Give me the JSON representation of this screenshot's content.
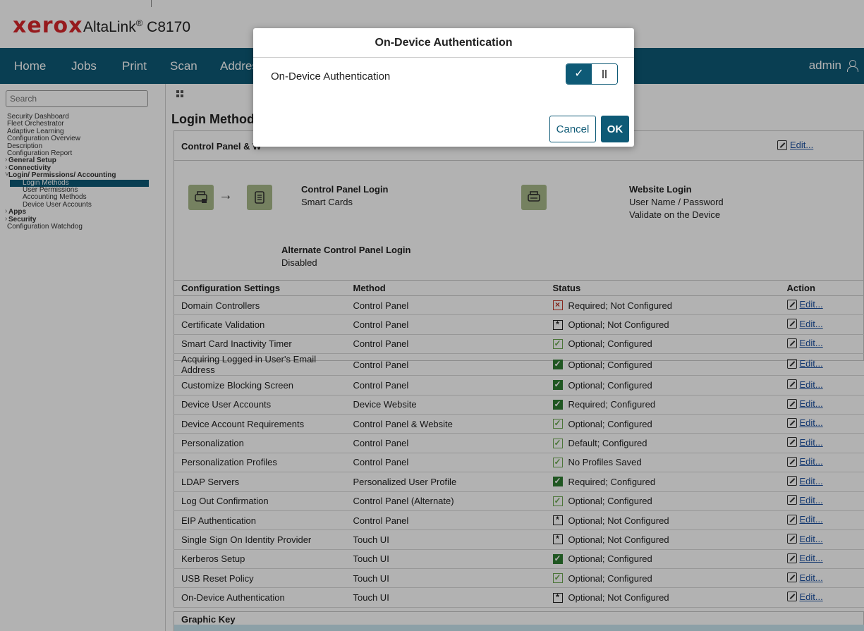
{
  "brand": {
    "logo": "xerox",
    "product": "AltaLink",
    "product_reg": "®",
    "model": " C8170"
  },
  "nav": {
    "items": [
      "Home",
      "Jobs",
      "Print",
      "Scan",
      "Address Book"
    ],
    "user": "admin",
    "user_icon": "user-icon"
  },
  "sidebar": {
    "search_placeholder": "Search",
    "items": {
      "security_dashboard": "Security Dashboard",
      "fleet_orchestrator": "Fleet Orchestrator",
      "adaptive_learning": "Adaptive Learning",
      "configuration_overview": "Configuration Overview",
      "description": "Description",
      "configuration_report": "Configuration Report",
      "general_setup": "General Setup",
      "connectivity": "Connectivity",
      "login_group": "Login/ Permissions/ Accounting",
      "login_methods": "Login Methods",
      "user_permissions": "User Permissions",
      "accounting_methods": "Accounting Methods",
      "device_user_accounts": "Device User Accounts",
      "apps": "Apps",
      "security": "Security",
      "configuration_watchdog": "Configuration Watchdog"
    }
  },
  "main": {
    "page_title": "Login Methods",
    "panel_title": "Control Panel & W",
    "edit_label": "Edit...",
    "control_panel_login": {
      "title": "Control Panel Login",
      "value": "Smart Cards"
    },
    "website_login": {
      "title": "Website Login",
      "line1": "User Name / Password",
      "line2": "Validate on the Device"
    },
    "alternate_login": {
      "title": "Alternate Control Panel Login",
      "value": "Disabled"
    },
    "table": {
      "headers": [
        "Configuration Settings",
        "Method",
        "Status",
        "Action"
      ],
      "rows": [
        {
          "setting": "Domain Controllers",
          "method": "Control Panel",
          "status": "Required; Not Configured",
          "icon": "x",
          "action": "Edit..."
        },
        {
          "setting": "Certificate Validation",
          "method": "Control Panel",
          "status": "Optional; Not Configured",
          "icon": "star",
          "action": "Edit..."
        },
        {
          "setting": "Smart Card Inactivity Timer",
          "method": "Control Panel",
          "status": "Optional; Configured",
          "icon": "check-light",
          "action": "Edit..."
        },
        {
          "setting": "Acquiring Logged in User's Email Address",
          "method": "Control Panel",
          "status": "Optional; Configured",
          "icon": "check-dark",
          "action": "Edit..."
        },
        {
          "setting": "Customize Blocking Screen",
          "method": "Control Panel",
          "status": "Optional; Configured",
          "icon": "check-dark",
          "action": "Edit..."
        },
        {
          "setting": "Device User Accounts",
          "method": "Device Website",
          "status": "Required; Configured",
          "icon": "check-dark",
          "action": "Edit..."
        },
        {
          "setting": "Device Account Requirements",
          "method": "Control Panel & Website",
          "status": "Optional; Configured",
          "icon": "check-light",
          "action": "Edit..."
        },
        {
          "setting": "Personalization",
          "method": "Control Panel",
          "status": "Default; Configured",
          "icon": "check-light",
          "action": "Edit..."
        },
        {
          "setting": "Personalization Profiles",
          "method": "Control Panel",
          "status": "No Profiles Saved",
          "icon": "check-light",
          "action": "Edit..."
        },
        {
          "setting": "LDAP Servers",
          "method": "Personalized User Profile",
          "status": "Required; Configured",
          "icon": "check-dark",
          "action": "Edit..."
        },
        {
          "setting": "Log Out Confirmation",
          "method": "Control Panel (Alternate)",
          "status": "Optional; Configured",
          "icon": "check-light",
          "action": "Edit..."
        },
        {
          "setting": "EIP Authentication",
          "method": "Control Panel",
          "status": "Optional; Not Configured",
          "icon": "star",
          "action": "Edit..."
        },
        {
          "setting": "Single Sign On Identity Provider",
          "method": "Touch UI",
          "status": "Optional; Not Configured",
          "icon": "star",
          "action": "Edit..."
        },
        {
          "setting": "Kerberos Setup",
          "method": "Touch UI",
          "status": "Optional; Configured",
          "icon": "check-dark",
          "action": "Edit..."
        },
        {
          "setting": "USB Reset Policy",
          "method": "Touch UI",
          "status": "Optional; Configured",
          "icon": "check-light",
          "action": "Edit..."
        },
        {
          "setting": "On-Device Authentication",
          "method": "Touch UI",
          "status": "Optional; Not Configured",
          "icon": "star",
          "action": "Edit..."
        }
      ]
    },
    "graphic_key": "Graphic Key"
  },
  "modal": {
    "title": "On-Device Authentication",
    "label": "On-Device Authentication",
    "toggle_state": "on",
    "cancel_label": "Cancel",
    "ok_label": "OK"
  },
  "colors": {
    "brand_red": "#d7262a",
    "nav_teal": "#0e5a76",
    "ok_green": "#2e7d32",
    "error_red": "#c0392b"
  }
}
